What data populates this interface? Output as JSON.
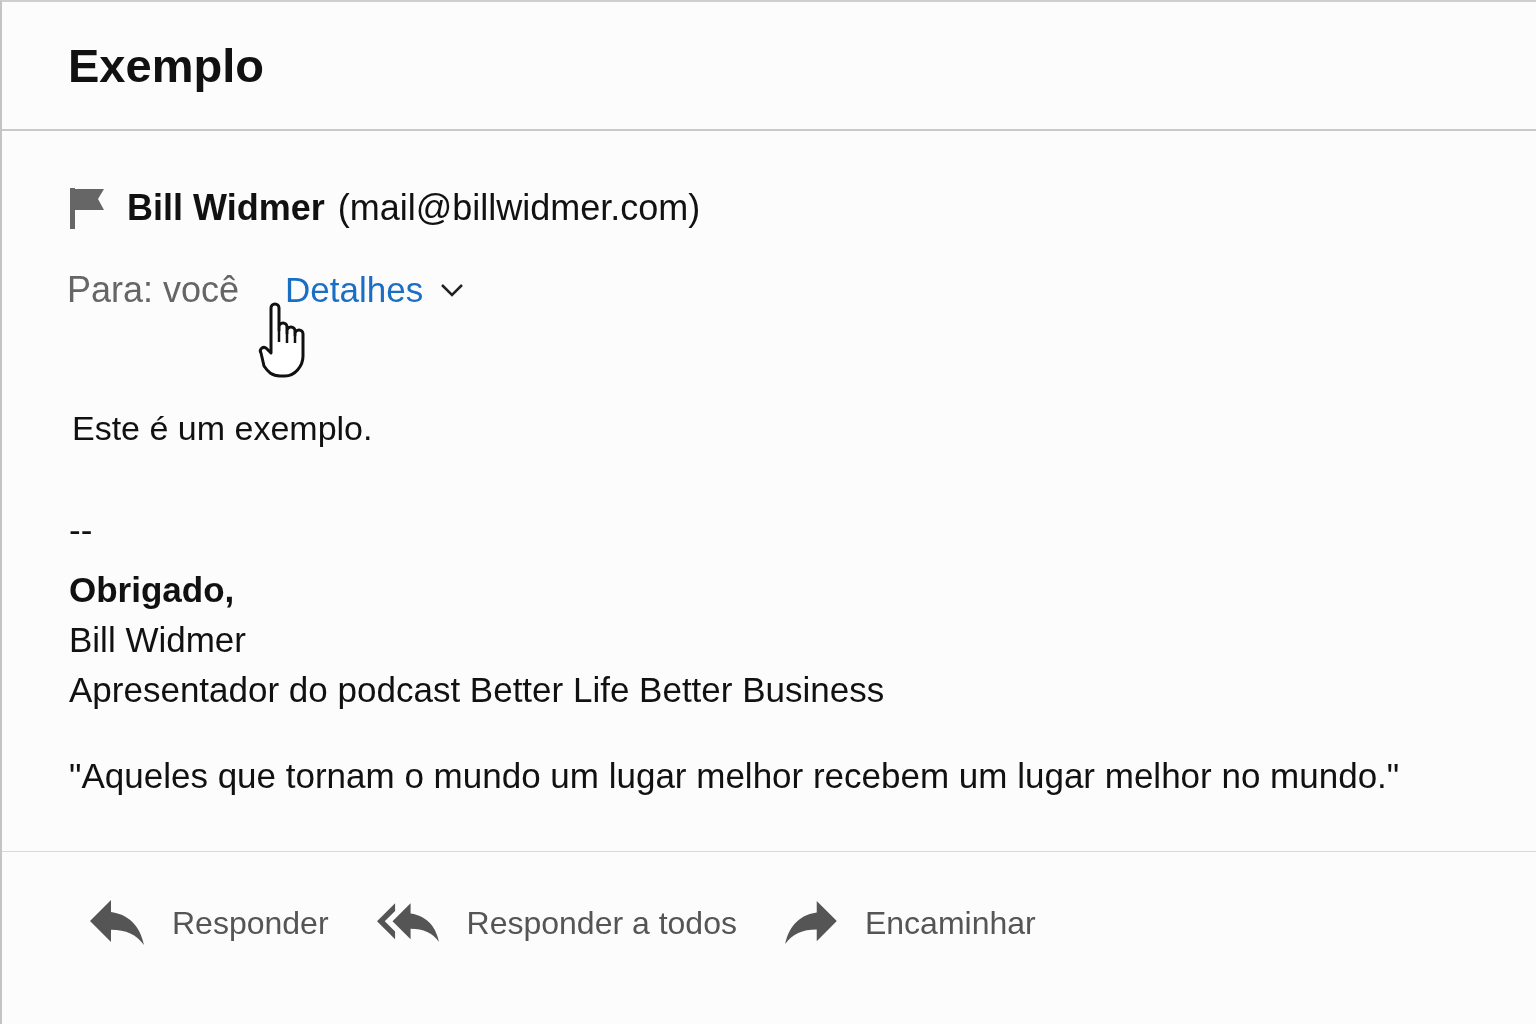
{
  "header": {
    "title": "Exemplo"
  },
  "message": {
    "sender": {
      "name": "Bill Widmer",
      "email": "(mail@billwidmer.com)"
    },
    "recipient": "Para: você",
    "details_link": "Detalhes",
    "body": "Este é um exemplo.",
    "signature": {
      "separator": "--",
      "closing": "Obrigado,",
      "lines": [
        "Bill Widmer",
        "Apresentador do podcast Better Life Better Business"
      ],
      "quote": "\"Aqueles que tornam o mundo um lugar melhor recebem um lugar melhor no mundo.\""
    }
  },
  "actions": [
    {
      "kind": "reply",
      "label": "Responder"
    },
    {
      "kind": "reply_all",
      "label": "Responder a todos"
    },
    {
      "kind": "forward",
      "label": "Encaminhar"
    }
  ]
}
